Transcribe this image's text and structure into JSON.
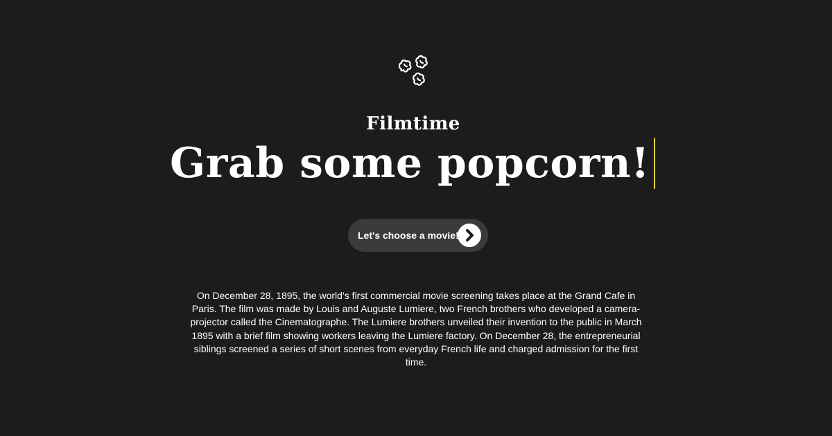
{
  "logo": {
    "icon": "popcorn-icon"
  },
  "brand": {
    "name": "Filmtime"
  },
  "hero": {
    "headline": "Grab some popcorn!"
  },
  "cta": {
    "label": "Let's choose a movie!",
    "icon": "chevron-right-icon"
  },
  "description": {
    "text": "On December 28, 1895, the world’s first commercial movie screening takes place at the Grand Cafe in Paris. The film was made by Louis and Auguste Lumiere, two French brothers who developed a camera-projector called the Cinematographe. The Lumiere brothers unveiled their invention to the public in March 1895 with a brief film showing workers leaving the Lumiere factory. On December 28, the entrepreneurial siblings screened a series of short scenes from everyday French life and charged admission for the first time."
  },
  "colors": {
    "background": "#1c1c1c",
    "button": "#3b3b3b",
    "cursor": "#e3d23f",
    "text": "#ffffff"
  }
}
